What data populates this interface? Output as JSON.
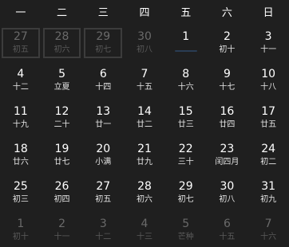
{
  "weekdays": [
    "一",
    "二",
    "三",
    "四",
    "五",
    "六",
    "日"
  ],
  "days": [
    {
      "num": "27",
      "lunar": "初五",
      "other": true,
      "outlined": true
    },
    {
      "num": "28",
      "lunar": "初六",
      "other": true,
      "outlined": true
    },
    {
      "num": "29",
      "lunar": "初七",
      "other": true,
      "outlined": true
    },
    {
      "num": "30",
      "lunar": "初八",
      "other": true
    },
    {
      "num": "1",
      "lunar": "",
      "today": true
    },
    {
      "num": "2",
      "lunar": "初十"
    },
    {
      "num": "3",
      "lunar": "十一"
    },
    {
      "num": "4",
      "lunar": "十二"
    },
    {
      "num": "5",
      "lunar": "立夏"
    },
    {
      "num": "6",
      "lunar": "十四"
    },
    {
      "num": "7",
      "lunar": "十五"
    },
    {
      "num": "8",
      "lunar": "十六"
    },
    {
      "num": "9",
      "lunar": "十七"
    },
    {
      "num": "10",
      "lunar": "十八"
    },
    {
      "num": "11",
      "lunar": "十九"
    },
    {
      "num": "12",
      "lunar": "二十"
    },
    {
      "num": "13",
      "lunar": "廿一"
    },
    {
      "num": "14",
      "lunar": "廿二"
    },
    {
      "num": "15",
      "lunar": "廿三"
    },
    {
      "num": "16",
      "lunar": "廿四"
    },
    {
      "num": "17",
      "lunar": "廿五"
    },
    {
      "num": "18",
      "lunar": "廿六"
    },
    {
      "num": "19",
      "lunar": "廿七"
    },
    {
      "num": "20",
      "lunar": "小满"
    },
    {
      "num": "21",
      "lunar": "廿九"
    },
    {
      "num": "22",
      "lunar": "三十"
    },
    {
      "num": "23",
      "lunar": "闰四月"
    },
    {
      "num": "24",
      "lunar": "初二"
    },
    {
      "num": "25",
      "lunar": "初三"
    },
    {
      "num": "26",
      "lunar": "初四"
    },
    {
      "num": "27",
      "lunar": "初五"
    },
    {
      "num": "28",
      "lunar": "初六"
    },
    {
      "num": "29",
      "lunar": "初七"
    },
    {
      "num": "30",
      "lunar": "初八"
    },
    {
      "num": "31",
      "lunar": "初九"
    },
    {
      "num": "1",
      "lunar": "初十",
      "other": true
    },
    {
      "num": "2",
      "lunar": "十一",
      "other": true
    },
    {
      "num": "3",
      "lunar": "十二",
      "other": true
    },
    {
      "num": "4",
      "lunar": "十三",
      "other": true
    },
    {
      "num": "5",
      "lunar": "芒种",
      "other": true
    },
    {
      "num": "6",
      "lunar": "十五",
      "other": true
    },
    {
      "num": "7",
      "lunar": "十六",
      "other": true
    }
  ],
  "colors": {
    "background": "#1f1f1f",
    "text": "#ffffff",
    "other_month_text": "#6a6a6a",
    "today_indicator": "#2a3d54"
  }
}
